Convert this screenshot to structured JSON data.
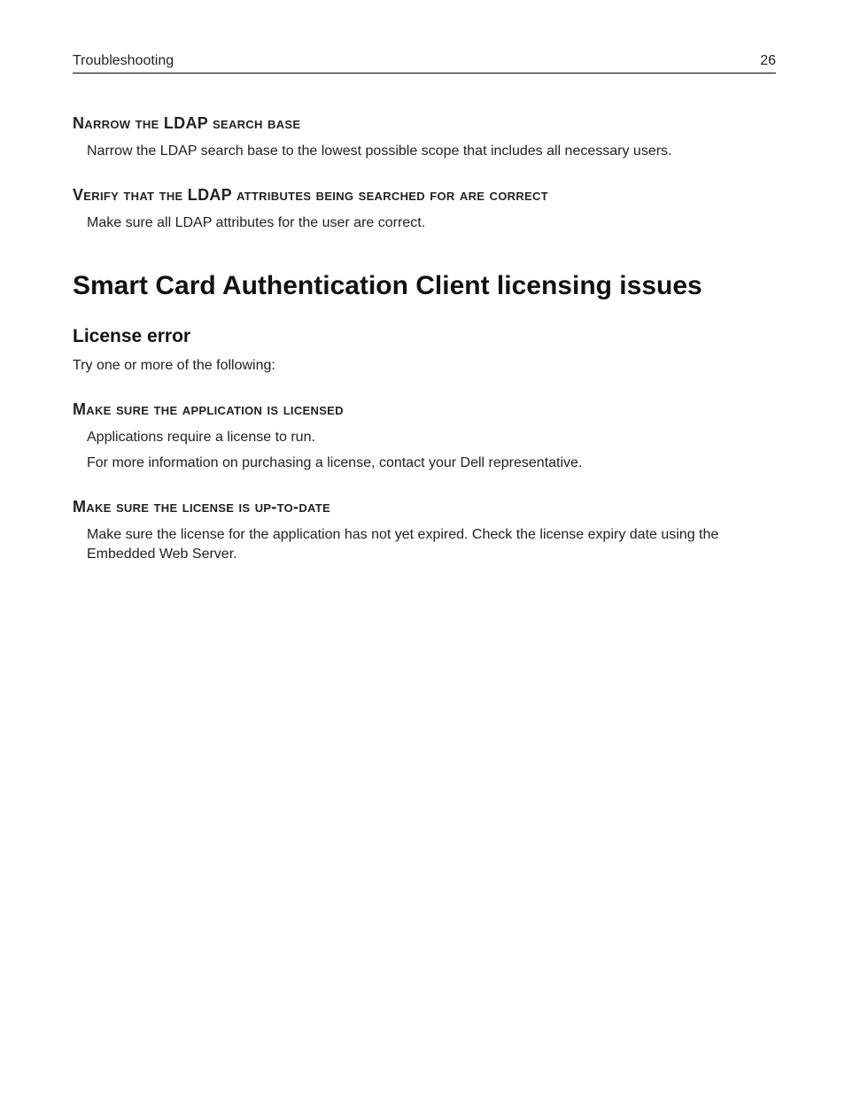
{
  "header": {
    "section": "Troubleshooting",
    "pageNumber": "26"
  },
  "ldapNarrow": {
    "heading": "Narrow the LDAP search base",
    "body": "Narrow the LDAP search base to the lowest possible scope that includes all necessary users."
  },
  "ldapVerify": {
    "heading": "Verify that the LDAP attributes being searched for are correct",
    "body": "Make sure all LDAP attributes for the user are correct."
  },
  "licensingTitle": "Smart Card Authentication Client licensing issues",
  "licenseError": {
    "heading": "License error",
    "intro": "Try one or more of the following:"
  },
  "appLicensed": {
    "heading": "Make sure the application is licensed",
    "line1": "Applications require a license to run.",
    "line2": "For more information on purchasing a license, contact your Dell representative."
  },
  "licenseUpToDate": {
    "heading": "Make sure the license is up-to-date",
    "body": "Make sure the license for the application has not yet expired. Check the license expiry date using the Embedded Web Server."
  }
}
